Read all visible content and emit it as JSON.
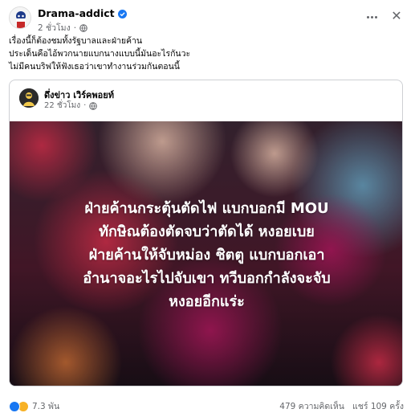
{
  "header": {
    "page_name": "Drama-addict",
    "time": "2 ชั่วโมง"
  },
  "post": {
    "lines": [
      "เรื่องนี้ก็ต้องชมทั้งรัฐบาลและฝ่ายค้าน",
      "ประเด็นคือไอ้พวกนายแบกนางแบบนี้มันอะไรกันวะ",
      "ไม่มีคนบริฟให้ฟังเธอว่าเขาทำงานร่วมกันตอนนี้"
    ]
  },
  "shared_post": {
    "page_name": "ดึ่งข่าว เวิร์คพอยท์",
    "time": "22 ชั่วโมง",
    "image_lines": [
      "ฝ่ายค้านกระตุ้นตัดไฟ แบกบอกมี MOU",
      "ทักษิณต้องตัดจบว่าตัดได้ หงอยเบย",
      "ฝ่ายค้านให้จับหม่อง ชิตตู แบกบอกเอา",
      "อำนาจอะไรไปจับเขา ทวีบอกกำลังจะจับ",
      "หงอยอีกแร่ะ"
    ]
  },
  "footer": {
    "reaction_count": "7.3 พัน",
    "comments": "479 ความคิดเห็น",
    "shares": "แชร์ 109 ครั้ง"
  },
  "colors": {
    "verified": "#1877f2",
    "secondary_text": "#65676b",
    "image_background": "#241420"
  }
}
